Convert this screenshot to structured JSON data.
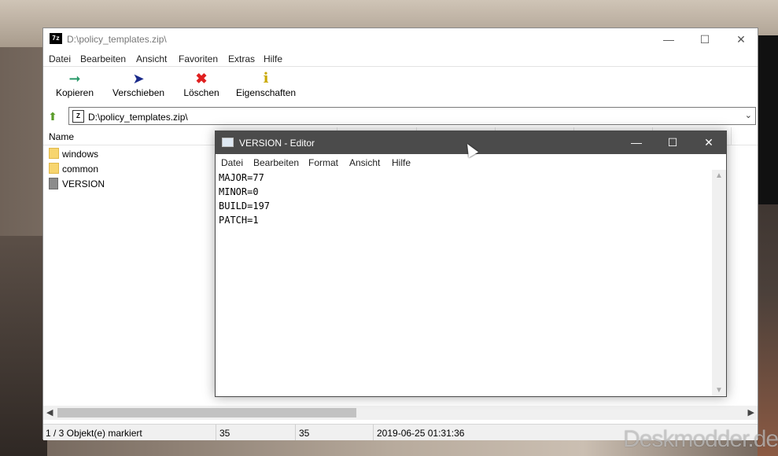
{
  "sevenzip": {
    "title": "D:\\policy_templates.zip\\",
    "app_icon": "7z",
    "menu": [
      "Datei",
      "Bearbeiten",
      "Ansicht",
      "Favoriten",
      "Extras",
      "Hilfe"
    ],
    "toolbar": [
      {
        "label": "Kopieren",
        "icon": "copy-arrow-icon",
        "color": "#2a9a6a"
      },
      {
        "label": "Verschieben",
        "icon": "move-arrow-icon",
        "color": "#1a2a8a"
      },
      {
        "label": "Löschen",
        "icon": "delete-x-icon",
        "color": "#e02020"
      },
      {
        "label": "Eigenschaften",
        "icon": "info-icon",
        "color": "#d9b800"
      }
    ],
    "address": "D:\\policy_templates.zip\\",
    "column_name": "Name",
    "files": [
      {
        "name": "windows",
        "type": "folder"
      },
      {
        "name": "common",
        "type": "folder"
      },
      {
        "name": "VERSION",
        "type": "file"
      }
    ],
    "status": {
      "selected": "1 / 3 Objekt(e) markiert",
      "size": "35",
      "packed": "35",
      "modified": "2019-06-25 01:31:36"
    }
  },
  "notepad": {
    "title": "VERSION - Editor",
    "menu": [
      "Datei",
      "Bearbeiten",
      "Format",
      "Ansicht",
      "Hilfe"
    ],
    "lines": [
      "MAJOR=77",
      "MINOR=0",
      "BUILD=197",
      "PATCH=1"
    ]
  },
  "watermark": "Deskmodder.de"
}
